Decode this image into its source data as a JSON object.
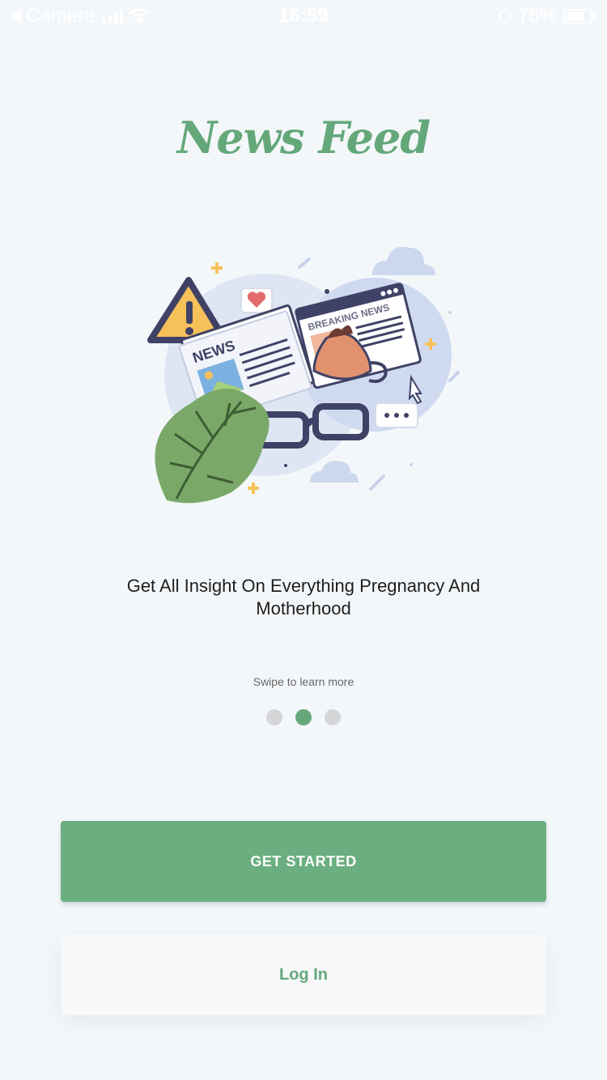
{
  "status_bar": {
    "back_app": "Camera",
    "time": "16:59",
    "battery": "76%",
    "battery_level": 0.76
  },
  "app": {
    "title": "News Feed"
  },
  "onboarding": {
    "headline": "Get All Insight On Everything Pregnancy And Motherhood",
    "swipe_hint": "Swipe to learn more",
    "page_count": 3,
    "active_page": 2,
    "illustration": {
      "news_label": "NEWS",
      "breaking_label": "BREAKING NEWS"
    }
  },
  "buttons": {
    "get_started": "GET STARTED",
    "log_in": "Log In"
  },
  "colors": {
    "brand_green": "#64a87a",
    "button_green": "#6bae80",
    "background": "#f4f7fa"
  }
}
